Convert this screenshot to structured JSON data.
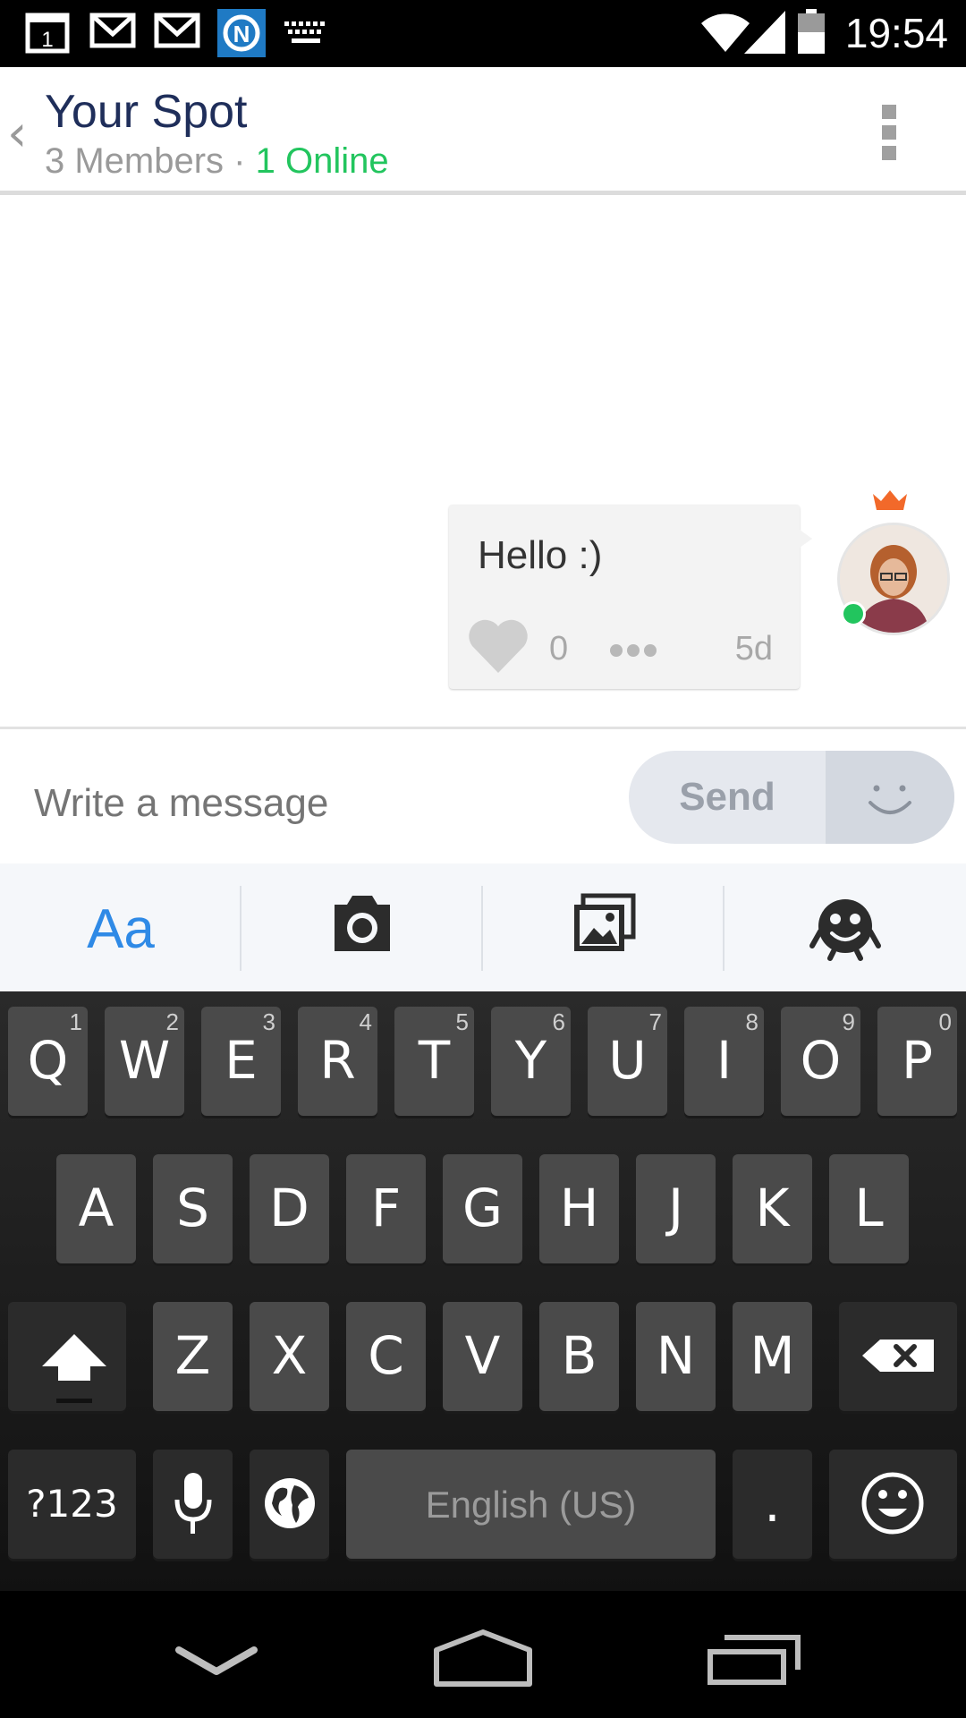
{
  "status_bar": {
    "time": "19:54",
    "left_icons": [
      "calendar-icon",
      "gmail-icon",
      "gmail-icon",
      "app-notification-icon",
      "keyboard-icon"
    ],
    "calendar_day": "1",
    "right_icons": [
      "wifi-icon",
      "signal-icon",
      "battery-icon"
    ]
  },
  "header": {
    "title": "Your Spot",
    "members": "3 Members",
    "separator": " · ",
    "online": "1 Online"
  },
  "message": {
    "text": "Hello :)",
    "likes": "0",
    "time": "5d"
  },
  "composer": {
    "placeholder": "Write a message",
    "send_label": "Send"
  },
  "toolbar": {
    "text_label": "Aa",
    "items": [
      "text-format",
      "camera",
      "gallery",
      "stickers"
    ]
  },
  "keyboard": {
    "row1": [
      {
        "key": "Q",
        "hint": "1"
      },
      {
        "key": "W",
        "hint": "2"
      },
      {
        "key": "E",
        "hint": "3"
      },
      {
        "key": "R",
        "hint": "4"
      },
      {
        "key": "T",
        "hint": "5"
      },
      {
        "key": "Y",
        "hint": "6"
      },
      {
        "key": "U",
        "hint": "7"
      },
      {
        "key": "I",
        "hint": "8"
      },
      {
        "key": "O",
        "hint": "9"
      },
      {
        "key": "P",
        "hint": "0"
      }
    ],
    "row2": [
      "A",
      "S",
      "D",
      "F",
      "G",
      "H",
      "J",
      "K",
      "L"
    ],
    "row3": [
      "Z",
      "X",
      "C",
      "V",
      "B",
      "N",
      "M"
    ],
    "symbols_label": "?123",
    "space_label": "English (US)",
    "period_label": "."
  },
  "colors": {
    "online_green": "#22c55e",
    "title_navy": "#1f2e5a",
    "accent_blue": "#2f8ae6",
    "crown_orange": "#f2692a"
  }
}
